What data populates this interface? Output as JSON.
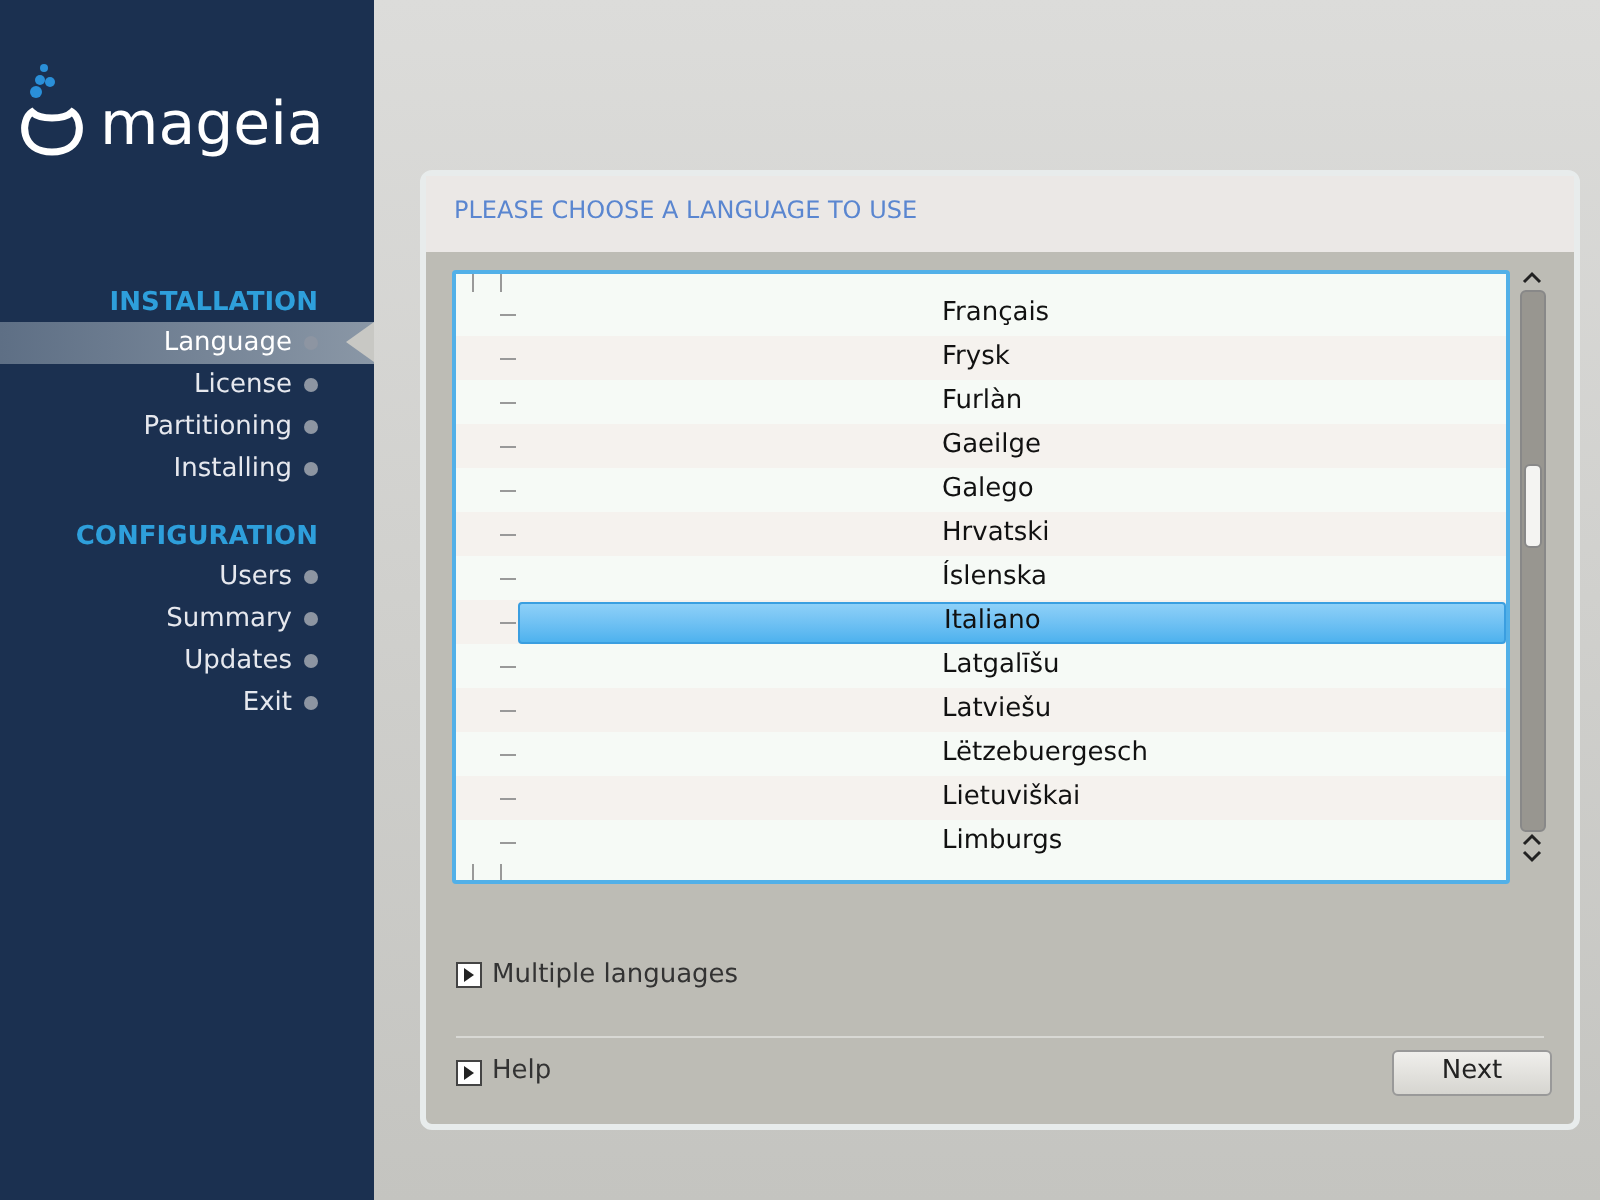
{
  "logo": {
    "text": "mageia"
  },
  "sidebar": {
    "sections": [
      {
        "title": "INSTALLATION",
        "items": [
          {
            "label": "Language",
            "selected": true
          },
          {
            "label": "License",
            "selected": false
          },
          {
            "label": "Partitioning",
            "selected": false
          },
          {
            "label": "Installing",
            "selected": false
          }
        ]
      },
      {
        "title": "CONFIGURATION",
        "items": [
          {
            "label": "Users",
            "selected": false
          },
          {
            "label": "Summary",
            "selected": false
          },
          {
            "label": "Updates",
            "selected": false
          },
          {
            "label": "Exit",
            "selected": false
          }
        ]
      }
    ]
  },
  "panel": {
    "title": "PLEASE CHOOSE A LANGUAGE TO USE",
    "languages": [
      {
        "label": "Français",
        "selected": false
      },
      {
        "label": "Frysk",
        "selected": false
      },
      {
        "label": "Furlàn",
        "selected": false
      },
      {
        "label": "Gaeilge",
        "selected": false
      },
      {
        "label": "Galego",
        "selected": false
      },
      {
        "label": "Hrvatski",
        "selected": false
      },
      {
        "label": "Íslenska",
        "selected": false
      },
      {
        "label": "Italiano",
        "selected": true
      },
      {
        "label": "Latgalīšu",
        "selected": false
      },
      {
        "label": "Latviešu",
        "selected": false
      },
      {
        "label": "Lëtzebuergesch",
        "selected": false
      },
      {
        "label": "Lietuviškai",
        "selected": false
      },
      {
        "label": "Limburgs",
        "selected": false
      }
    ],
    "multiple_languages": {
      "label": "Multiple languages",
      "expanded": false
    },
    "help": {
      "label": "Help",
      "expanded": false
    },
    "next_button": "Next"
  }
}
